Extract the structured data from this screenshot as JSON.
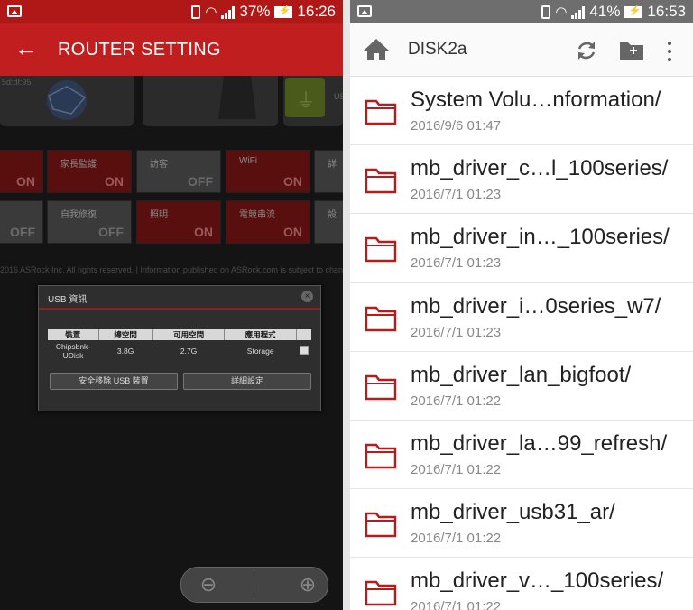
{
  "left": {
    "status": {
      "battery": "37%",
      "time": "16:26"
    },
    "header": {
      "title": "ROUTER SETTING"
    },
    "router": {
      "mac_fragment": "5d:df:95",
      "usb_card_label": "US",
      "tiles": [
        {
          "label": "",
          "state": "ON"
        },
        {
          "label": "家長監護",
          "state": "ON"
        },
        {
          "label": "訪客",
          "state": "OFF"
        },
        {
          "label": "WiFi",
          "state": "ON"
        },
        {
          "label": "詳",
          "state": ""
        },
        {
          "label": "",
          "state": "OFF"
        },
        {
          "label": "自我修復",
          "state": "OFF"
        },
        {
          "label": "照明",
          "state": "ON"
        },
        {
          "label": "電競串流",
          "state": "ON"
        },
        {
          "label": "設",
          "state": ""
        }
      ],
      "copyright": "2016 ASRock Inc. All rights reserved. | Information published on ASRock.com is subject to change"
    },
    "usb_dialog": {
      "title": "USB 資訊",
      "columns": [
        "裝置",
        "總空間",
        "可用空間",
        "應用程式"
      ],
      "row": {
        "device": "Chipsbnk-UDisk",
        "total": "3.8G",
        "free": "2.7G",
        "app": "Storage"
      },
      "eject_button": "安全移除 USB 裝置",
      "settings_button": "詳細設定"
    }
  },
  "right": {
    "status": {
      "battery": "41%",
      "time": "16:53"
    },
    "header": {
      "title": "DISK2a"
    },
    "files": [
      {
        "name": "System Volu…nformation/",
        "date": "2016/9/6 01:47"
      },
      {
        "name": "mb_driver_c…l_100series/",
        "date": "2016/7/1 01:23"
      },
      {
        "name": "mb_driver_in…_100series/",
        "date": "2016/7/1 01:23"
      },
      {
        "name": "mb_driver_i…0series_w7/",
        "date": "2016/7/1 01:23"
      },
      {
        "name": "mb_driver_lan_bigfoot/",
        "date": "2016/7/1 01:22"
      },
      {
        "name": "mb_driver_la…99_refresh/",
        "date": "2016/7/1 01:22"
      },
      {
        "name": "mb_driver_usb31_ar/",
        "date": "2016/7/1 01:22"
      },
      {
        "name": "mb_driver_v…_100series/",
        "date": "2016/7/1 01:22"
      }
    ]
  },
  "colors": {
    "router_red": "#c11f1f",
    "folder_red": "#b71c1c"
  }
}
